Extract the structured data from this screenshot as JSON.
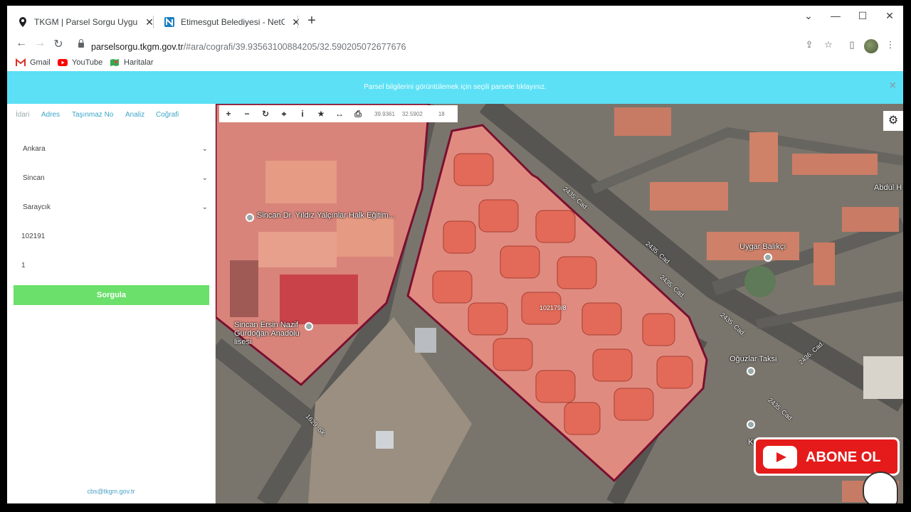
{
  "browser": {
    "tabs": [
      {
        "title": "TKGM | Parsel Sorgu Uygulaması",
        "active": true
      },
      {
        "title": "Etimesgut Belediyesi - NetGIS Harita",
        "active": false
      }
    ],
    "url_host": "parselsorgu.tkgm.gov.tr",
    "url_rest": "/#ara/cografi/39.93563100884205/32.590205072677676",
    "bookmarks": [
      "Gmail",
      "YouTube",
      "Haritalar"
    ]
  },
  "banner": {
    "message": "Parsel bilgilerini görüntülemek için seçili parsele tıklayınız.",
    "close": "×"
  },
  "sidebar": {
    "tabs": [
      "İdari",
      "Adres",
      "Taşınmaz No",
      "Analiz",
      "Coğrafi"
    ],
    "province": "Ankara",
    "district": "Sincan",
    "neighborhood": "Saraycık",
    "block": "102191",
    "parcel": "1",
    "query_button": "Sorgula",
    "footer_email": "cbs@tkgm.gov.tr"
  },
  "map": {
    "toolbar": {
      "lat": "39.9361",
      "lon": "32.5902",
      "zoom": "18"
    },
    "labels": {
      "school1": "Sincan Dr. Yıldız Yalçınlar Halk Eğitim...",
      "school2": "Sincan Ersin Nazif Gürdoğan Anadolu lisesi",
      "road1": "2435. Cad.",
      "road2": "2435. Cad.",
      "road3": "2435. Cad.",
      "road4": "2435. Cad.",
      "road5": "2435. Cad.",
      "road6": "2436. Cad.",
      "road7": "1629. Sk.",
      "uygar": "Uygar Balıkçı",
      "oguzlar": "Oğuzlar Taksi",
      "abdul": "Abdül H",
      "kul": "KUL"
    },
    "parcel_id": "102179/8"
  },
  "overlay": {
    "subscribe": "ABONE OL"
  }
}
